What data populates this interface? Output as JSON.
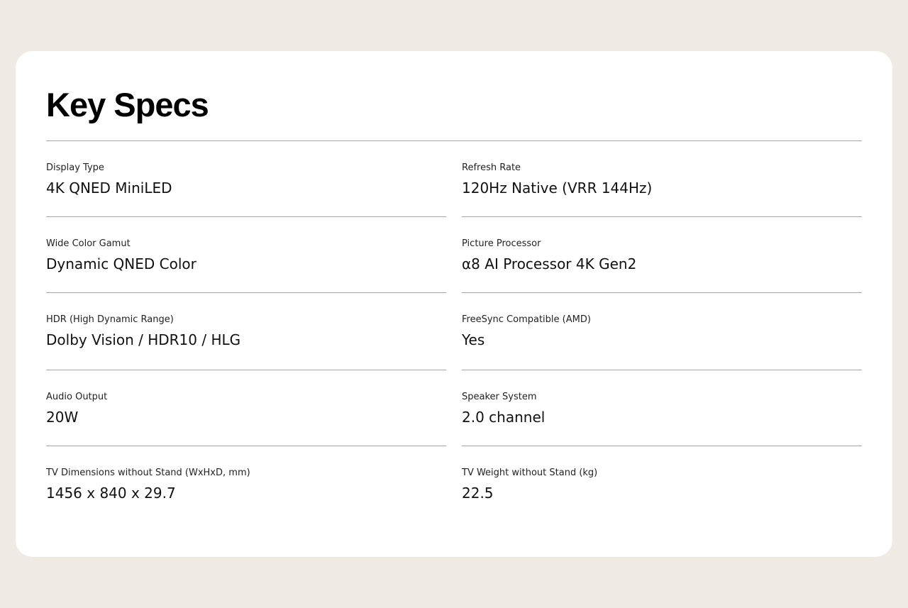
{
  "page": {
    "title": "Key Specs"
  },
  "specs": [
    {
      "label": "Display Type",
      "value": "4K QNED MiniLED"
    },
    {
      "label": "Refresh Rate",
      "value": "120Hz Native (VRR 144Hz)"
    },
    {
      "label": "Wide Color Gamut",
      "value": "Dynamic QNED Color"
    },
    {
      "label": "Picture Processor",
      "value": "α8 AI Processor 4K Gen2"
    },
    {
      "label": "HDR (High Dynamic Range)",
      "value": "Dolby Vision / HDR10 / HLG"
    },
    {
      "label": "FreeSync Compatible (AMD)",
      "value": "Yes"
    },
    {
      "label": "Audio Output",
      "value": "20W"
    },
    {
      "label": "Speaker System",
      "value": "2.0 channel"
    },
    {
      "label": "TV Dimensions without Stand (WxHxD, mm)",
      "value": "1456 x 840 x 29.7"
    },
    {
      "label": "TV Weight without Stand (kg)",
      "value": "22.5"
    }
  ]
}
